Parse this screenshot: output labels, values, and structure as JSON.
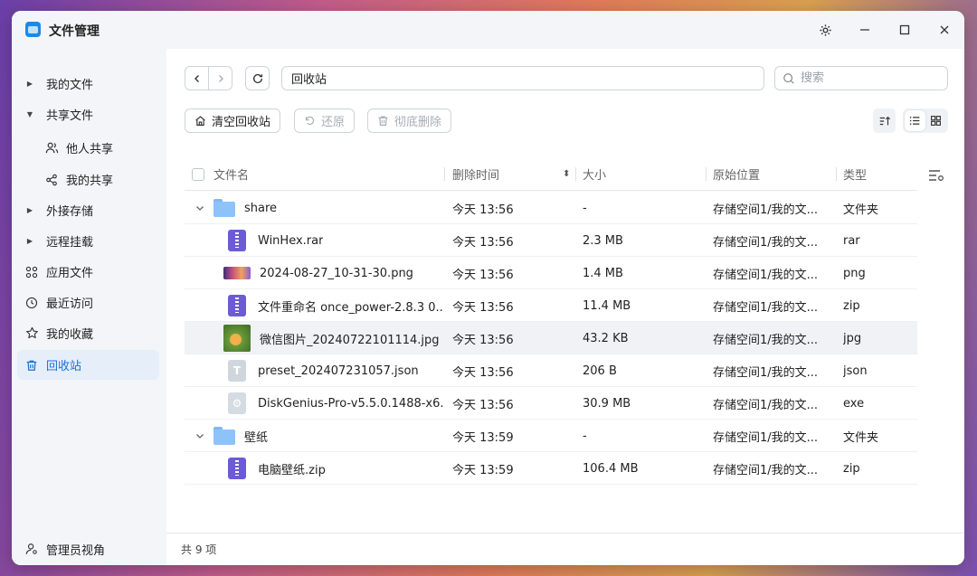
{
  "window": {
    "title": "文件管理"
  },
  "sidebar": {
    "items": [
      {
        "label": "我的文件"
      },
      {
        "label": "共享文件"
      },
      {
        "label": "他人共享"
      },
      {
        "label": "我的共享"
      },
      {
        "label": "外接存储"
      },
      {
        "label": "远程挂载"
      },
      {
        "label": "应用文件"
      },
      {
        "label": "最近访问"
      },
      {
        "label": "我的收藏"
      },
      {
        "label": "回收站"
      }
    ],
    "footer_label": "管理员视角"
  },
  "toolbar": {
    "path": "回收站",
    "search_placeholder": "搜索",
    "empty_label": "清空回收站",
    "restore_label": "还原",
    "delete_label": "彻底删除"
  },
  "table": {
    "headers": {
      "name": "文件名",
      "deleted": "删除时间",
      "size": "大小",
      "origin": "原始位置",
      "type": "类型"
    },
    "rows": [
      {
        "name": "share",
        "time": "今天 13:56",
        "size": "-",
        "origin": "存储空间1/我的文...",
        "type": "文件夹",
        "icon": "folder-icon"
      },
      {
        "name": "WinHex.rar",
        "time": "今天 13:56",
        "size": "2.3 MB",
        "origin": "存储空间1/我的文...",
        "type": "rar",
        "icon": "archive-icon"
      },
      {
        "name": "2024-08-27_10-31-30.png",
        "time": "今天 13:56",
        "size": "1.4 MB",
        "origin": "存储空间1/我的文...",
        "type": "png",
        "icon": "image-thumbnail"
      },
      {
        "name": "文件重命名 once_power-2.8.3 0...",
        "time": "今天 13:56",
        "size": "11.4 MB",
        "origin": "存储空间1/我的文...",
        "type": "zip",
        "icon": "archive-icon"
      },
      {
        "name": "微信图片_20240722101114.jpg",
        "time": "今天 13:56",
        "size": "43.2 KB",
        "origin": "存储空间1/我的文...",
        "type": "jpg",
        "icon": "image-thumbnail"
      },
      {
        "name": "preset_202407231057.json",
        "time": "今天 13:56",
        "size": "206 B",
        "origin": "存储空间1/我的文...",
        "type": "json",
        "icon": "text-file-icon"
      },
      {
        "name": "DiskGenius-Pro-v5.5.0.1488-x6...",
        "time": "今天 13:56",
        "size": "30.9 MB",
        "origin": "存储空间1/我的文...",
        "type": "exe",
        "icon": "exe-icon"
      },
      {
        "name": "壁纸",
        "time": "今天 13:59",
        "size": "-",
        "origin": "存储空间1/我的文...",
        "type": "文件夹",
        "icon": "folder-icon"
      },
      {
        "name": "电脑壁纸.zip",
        "time": "今天 13:59",
        "size": "106.4 MB",
        "origin": "存储空间1/我的文...",
        "type": "zip",
        "icon": "archive-icon"
      }
    ]
  },
  "status": {
    "count": "共 9 项"
  },
  "colors": {
    "accent": "#1a6fd6",
    "active_bg": "#e6eefa",
    "sidebar_bg": "#f3f5f8",
    "archive": "#6b5bd6",
    "folder": "#8ec3fa"
  }
}
